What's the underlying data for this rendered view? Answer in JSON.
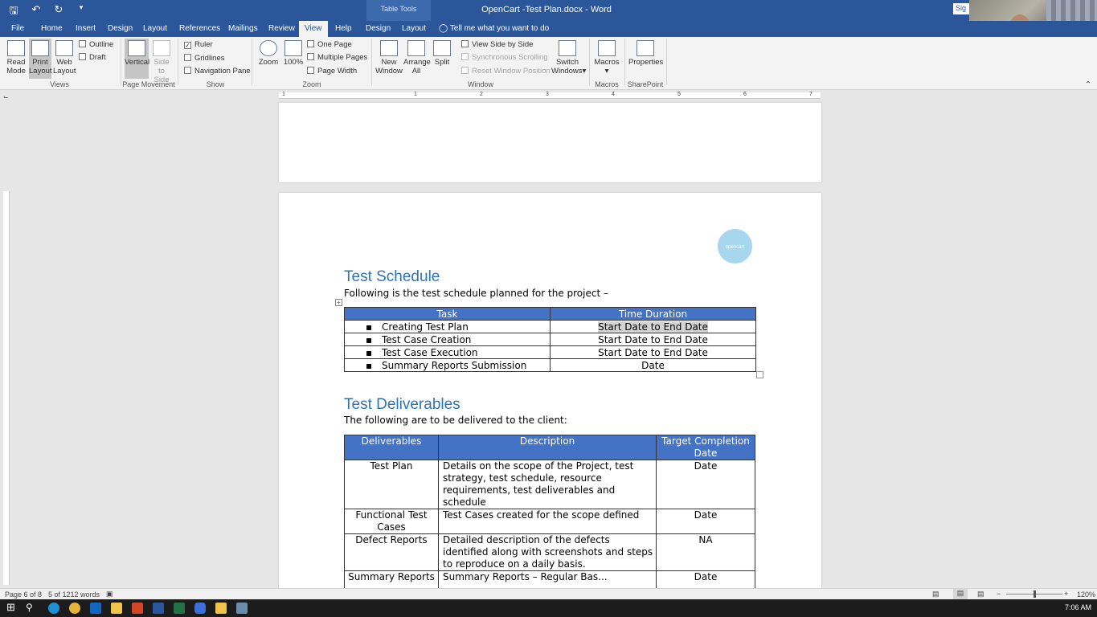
{
  "titlebar": {
    "document_title": "OpenCart -Test Plan.docx  -  Word",
    "table_tools": "Table Tools",
    "signin": "Sig",
    "qat": [
      "save-icon",
      "undo-icon",
      "redo-icon",
      "customize-icon"
    ]
  },
  "tabs": {
    "file": "File",
    "home": "Home",
    "insert": "Insert",
    "design": "Design",
    "layout": "Layout",
    "references": "References",
    "mailings": "Mailings",
    "review": "Review",
    "view": "View",
    "help": "Help",
    "table_design": "Design",
    "table_layout": "Layout",
    "tell_me": "Tell me what you want to do"
  },
  "ribbon": {
    "read_mode_1": "Read",
    "read_mode_2": "Mode",
    "print_layout_1": "Print",
    "print_layout_2": "Layout",
    "web_layout_1": "Web",
    "web_layout_2": "Layout",
    "outline": "Outline",
    "draft": "Draft",
    "views_group": "Views",
    "vertical": "Vertical",
    "side_1": "Side",
    "side_2": "to Side",
    "page_movement_group": "Page Movement",
    "ruler": "Ruler",
    "gridlines": "Gridlines",
    "navigation_pane": "Navigation Pane",
    "show_group": "Show",
    "zoom": "Zoom",
    "zoom100": "100%",
    "one_page": "One Page",
    "multiple_pages": "Multiple Pages",
    "page_width": "Page Width",
    "zoom_group": "Zoom",
    "new_window_1": "New",
    "new_window_2": "Window",
    "arrange_1": "Arrange",
    "arrange_2": "All",
    "split": "Split",
    "view_side_by_side": "View Side by Side",
    "sync_scrolling": "Synchronous Scrolling",
    "reset_window": "Reset Window Position",
    "switch_1": "Switch",
    "switch_2": "Windows",
    "window_group": "Window",
    "macros": "Macros",
    "macros_group": "Macros",
    "properties": "Properties",
    "sharepoint_group": "SharePoint"
  },
  "ruler_numbers": [
    "1",
    "1",
    "2",
    "3",
    "4",
    "5",
    "6",
    "7"
  ],
  "document": {
    "logo_text": "opencart",
    "schedule_heading": "Test Schedule",
    "schedule_intro": "Following is the test schedule planned for the project –",
    "schedule_table": {
      "headers": [
        "Task",
        "Time Duration"
      ],
      "rows": [
        [
          "Creating Test Plan",
          "Start Date to End Date"
        ],
        [
          "Test Case Creation",
          "Start Date to End Date"
        ],
        [
          "Test Case Execution",
          "Start Date to End Date"
        ],
        [
          "Summary Reports Submission",
          "Date"
        ]
      ]
    },
    "deliverables_heading": "Test Deliverables",
    "deliverables_intro": "The following are to be delivered to the client:",
    "deliverables_table": {
      "headers": [
        "Deliverables",
        "Description",
        "Target Completion Date"
      ],
      "rows": [
        [
          "Test Plan",
          "Details on the scope of the Project, test strategy, test schedule, resource requirements, test deliverables and schedule",
          "Date"
        ],
        [
          "Functional Test Cases",
          "Test Cases created for the scope defined",
          "Date"
        ],
        [
          "Defect Reports",
          "Detailed description of the defects identified along with screenshots and steps to reproduce on a daily basis.",
          "NA"
        ],
        [
          "Summary Reports",
          "Summary Reports – Regular Bas...",
          "Date"
        ]
      ]
    }
  },
  "status": {
    "page": "Page 6 of 8",
    "words": "5 of 1212 words",
    "zoom": "120%"
  },
  "taskbar": {
    "time": "7:06 AM"
  }
}
